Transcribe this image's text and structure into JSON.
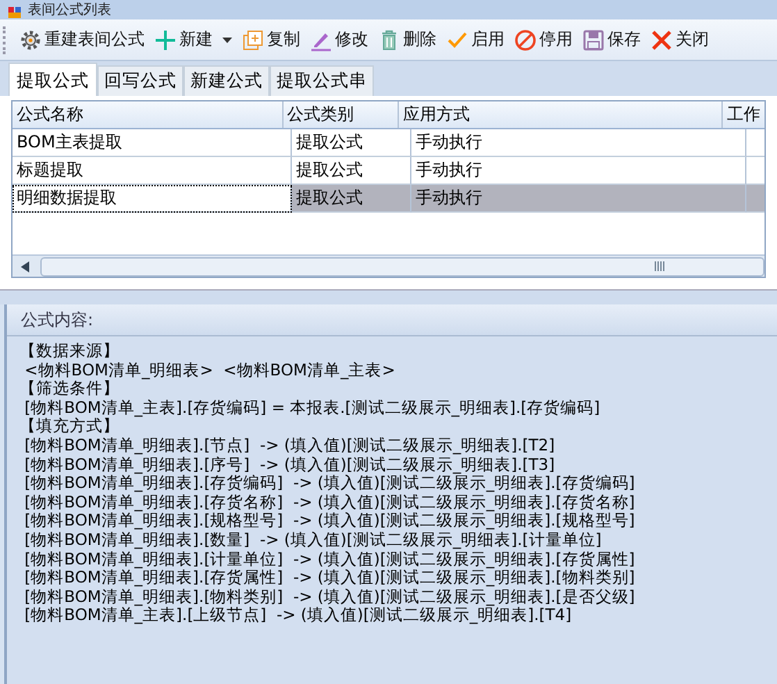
{
  "window": {
    "title": "表间公式列表"
  },
  "toolbar": [
    {
      "label": "重建表间公式",
      "kind": "gear",
      "dropdown": false
    },
    {
      "label": "新建",
      "kind": "plus",
      "dropdown": true
    },
    {
      "label": "复制",
      "kind": "copy",
      "dropdown": false
    },
    {
      "label": "修改",
      "kind": "pencil",
      "dropdown": false
    },
    {
      "label": "删除",
      "kind": "trash",
      "dropdown": false
    },
    {
      "label": "启用",
      "kind": "check",
      "dropdown": false
    },
    {
      "label": "停用",
      "kind": "ban",
      "dropdown": false
    },
    {
      "label": "保存",
      "kind": "save",
      "dropdown": false
    },
    {
      "label": "关闭",
      "kind": "close",
      "dropdown": false
    }
  ],
  "tabs": [
    {
      "label": "提取公式",
      "selected": true
    },
    {
      "label": "回写公式",
      "selected": false
    },
    {
      "label": "新建公式",
      "selected": false
    },
    {
      "label": "提取公式串",
      "selected": false
    }
  ],
  "table": {
    "columns": [
      "公式名称",
      "公式类别",
      "应用方式",
      "工作"
    ],
    "rows": [
      {
        "cells": [
          "BOM主表提取",
          "提取公式",
          "手动执行",
          ""
        ],
        "selected": false
      },
      {
        "cells": [
          "标题提取",
          "提取公式",
          "手动执行",
          ""
        ],
        "selected": false
      },
      {
        "cells": [
          "明细数据提取",
          "提取公式",
          "手动执行",
          ""
        ],
        "selected": true
      }
    ]
  },
  "content": {
    "title": "公式内容:",
    "lines": [
      "【数据来源】",
      " <物料BOM清单_明细表>  <物料BOM清单_主表>",
      "【筛选条件】",
      " [物料BOM清单_主表].[存货编码] = 本报表.[测试二级展示_明细表].[存货编码]",
      "【填充方式】",
      " [物料BOM清单_明细表].[节点]  -> (填入值)[测试二级展示_明细表].[T2]",
      " [物料BOM清单_明细表].[序号]  -> (填入值)[测试二级展示_明细表].[T3]",
      " [物料BOM清单_明细表].[存货编码]  -> (填入值)[测试二级展示_明细表].[存货编码]",
      " [物料BOM清单_明细表].[存货名称]  -> (填入值)[测试二级展示_明细表].[存货名称]",
      " [物料BOM清单_明细表].[规格型号]  -> (填入值)[测试二级展示_明细表].[规格型号]",
      " [物料BOM清单_明细表].[数量]  -> (填入值)[测试二级展示_明细表].[计量单位]",
      " [物料BOM清单_明细表].[计量单位]  -> (填入值)[测试二级展示_明细表].[存货属性]",
      " [物料BOM清单_明细表].[存货属性]  -> (填入值)[测试二级展示_明细表].[物料类别]",
      " [物料BOM清单_明细表].[物料类别]  -> (填入值)[测试二级展示_明细表].[是否父级]",
      " [物料BOM清单_主表].[上级节点]  -> (填入值)[测试二级展示_明细表].[T4]"
    ]
  }
}
